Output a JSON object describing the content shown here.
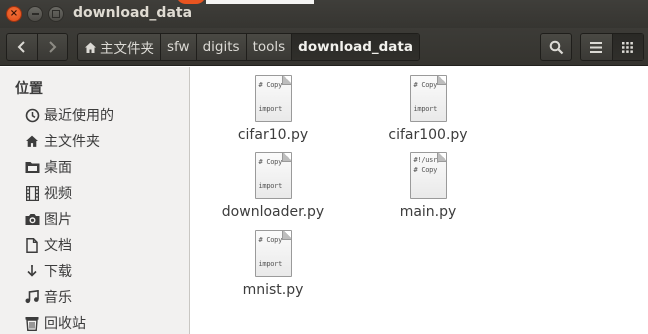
{
  "window": {
    "title": "download_data"
  },
  "toolbar": {
    "back_icon": "‹",
    "forward_icon": "›",
    "breadcrumbs": [
      "主文件夹",
      "sfw",
      "digits",
      "tools",
      "download_data"
    ]
  },
  "sidebar": {
    "heading": "位置",
    "items": [
      {
        "label": "最近使用的",
        "icon": "recent-icon"
      },
      {
        "label": "主文件夹",
        "icon": "home-icon"
      },
      {
        "label": "桌面",
        "icon": "desktop-icon"
      },
      {
        "label": "视频",
        "icon": "video-icon"
      },
      {
        "label": "图片",
        "icon": "pictures-icon"
      },
      {
        "label": "文档",
        "icon": "documents-icon"
      },
      {
        "label": "下载",
        "icon": "downloads-icon"
      },
      {
        "label": "音乐",
        "icon": "music-icon"
      },
      {
        "label": "回收站",
        "icon": "trash-icon"
      }
    ]
  },
  "files": [
    {
      "name": "cifar10.py",
      "preview": [
        "# Copy",
        "import"
      ]
    },
    {
      "name": "cifar100.py",
      "preview": [
        "# Copy",
        "import"
      ]
    },
    {
      "name": "downloader.py",
      "preview": [
        "# Copy",
        "import"
      ]
    },
    {
      "name": "main.py",
      "preview": [
        "#!/usr/",
        "# Copy"
      ]
    },
    {
      "name": "mnist.py",
      "preview": [
        "# Copy",
        "import"
      ]
    }
  ]
}
